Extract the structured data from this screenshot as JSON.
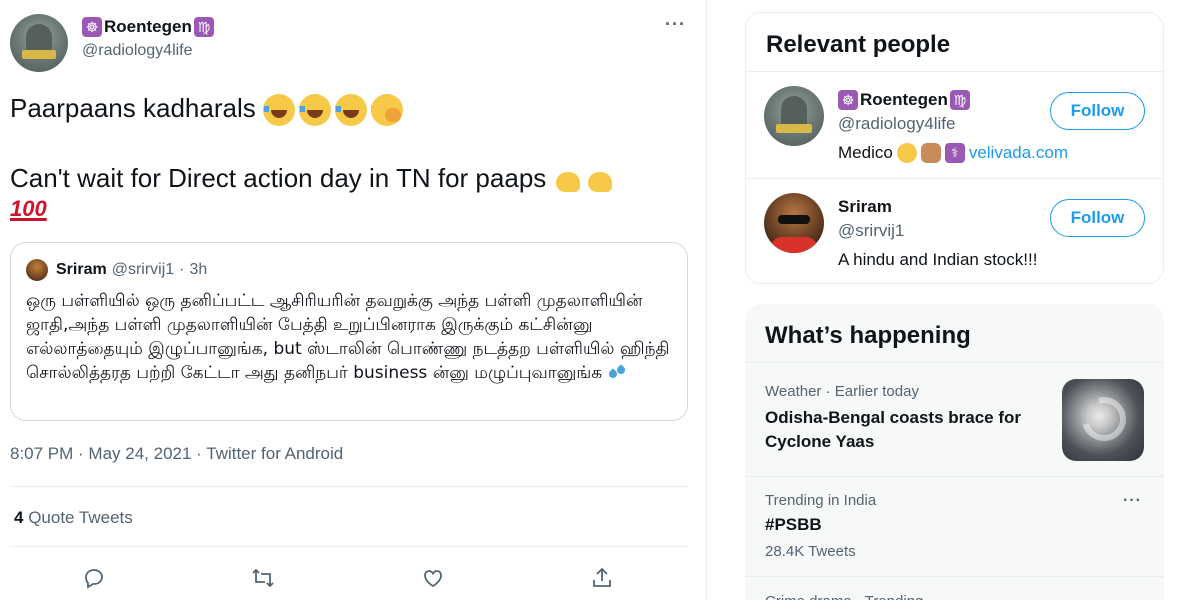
{
  "tweet": {
    "author_name": "Roentegen",
    "author_handle": "@radiology4life",
    "author_emoji_left": "☸",
    "author_emoji_right": "♍",
    "avatar_caption": "#MODI",
    "more_icon": "...",
    "text_line1": "Paarpaans kadharals",
    "text_line2": "Can't wait for Direct action day in TN for paaps",
    "emoji_line1": [
      "face-with-tears-of-joy",
      "face-with-tears-of-joy",
      "face-with-tears-of-joy",
      "face-with-hand-over-mouth"
    ],
    "emoji_line2": [
      "flexed-biceps",
      "flexed-biceps",
      "hundred-points"
    ],
    "hundred_text": "100",
    "quote": {
      "name": "Sriram",
      "handle": "@srirvij1",
      "separator": "·",
      "time": "3h",
      "body": "ஒரு பள்ளியில் ஒரு தனிப்பட்ட ஆசிரியரின் தவறுக்கு அந்த பள்ளி முதலாளியின் ஜாதி,அந்த பள்ளி முதலாளியின் பேத்தி உறுப்பினராக இருக்கும் கட்சின்னு எல்லாத்தையும் இழுப்பானுங்க, but ஸ்டாலின் பொண்ணு நடத்தற பள்ளியில் ஹிந்தி சொல்லித்தரத பற்றி கேட்டா அது தனிநபர் business ன்னு மழுப்புவானுங்க"
    },
    "timestamp": "8:07 PM · May 24, 2021 · Twitter for Android",
    "quote_count": "4",
    "quote_label": "Quote Tweets"
  },
  "actions": [
    "reply-icon",
    "retweet-icon",
    "like-icon",
    "share-icon"
  ],
  "relevant_people": {
    "title": "Relevant people",
    "people": [
      {
        "name": "Roentegen",
        "handle": "@radiology4life",
        "bio": "Medico",
        "bio_link": "velivada.com",
        "follow_label": "Follow"
      },
      {
        "name": "Sriram",
        "handle": "@srirvij1",
        "bio": "A hindu and Indian stock!!!",
        "follow_label": "Follow"
      }
    ]
  },
  "happening": {
    "title": "What’s happening",
    "trends": [
      {
        "meta": "Weather · Earlier today",
        "title_line1": "Odisha-Bengal coasts brace for",
        "title_line2": "Cyclone Yaas"
      },
      {
        "meta": "Trending in India",
        "title": "#PSBB",
        "count": "28.4K Tweets"
      },
      {
        "meta": "Crime drama · Trending"
      }
    ]
  },
  "colors": {
    "accent": "#1d9bf0",
    "text": "#0f1419",
    "muted": "#536471",
    "border": "#ebeef0",
    "panel_bg": "#f7f9f9"
  }
}
